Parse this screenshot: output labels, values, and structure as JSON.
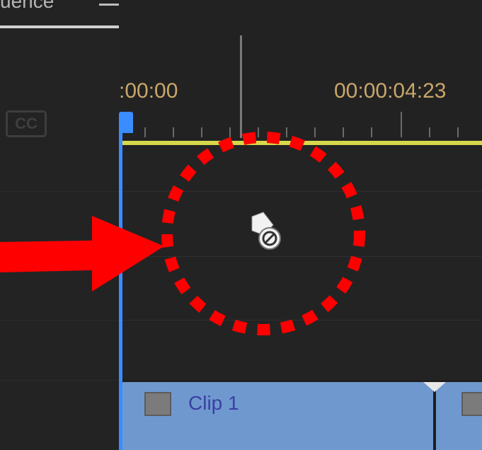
{
  "panel": {
    "tab_label": "uence",
    "menu_icon": "hamburger-menu-icon",
    "cc_label": "CC"
  },
  "timeline": {
    "timecode_start": ":00:00",
    "timecode_mark": "00:00:04:23"
  },
  "clips": [
    {
      "label": "Clip 1"
    }
  ],
  "annotation": {
    "arrow_color": "#ff0000",
    "circle_color": "#ff0000",
    "cursor_icon": "drag-no-drop-cursor-icon"
  },
  "colors": {
    "playhead": "#3a8cff",
    "work_area": "#d6d84a",
    "clip": "#6f98cf",
    "timecode": "#c9a76a"
  }
}
